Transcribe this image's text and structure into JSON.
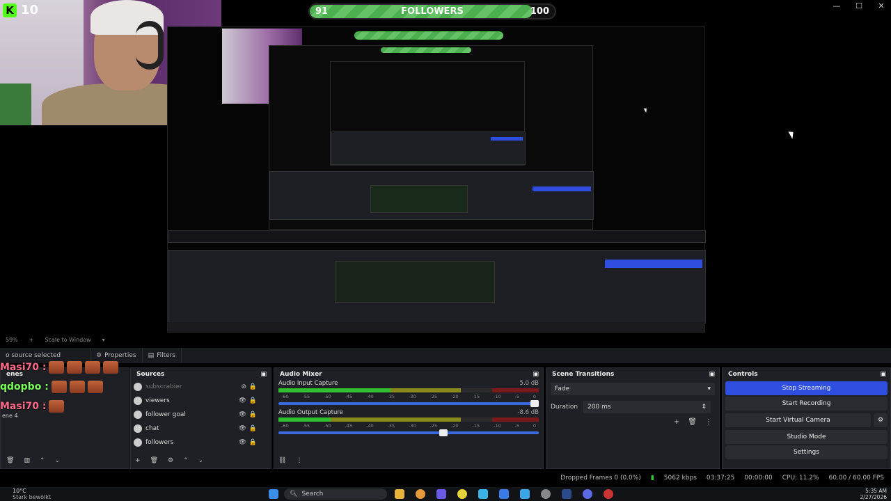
{
  "webcam": {
    "kick_count": "10"
  },
  "followers_bar": {
    "current": "91",
    "label": "FOLLOWERS",
    "goal": "100",
    "progress": 0.91
  },
  "window_controls": {
    "minimize": "—",
    "maximize": "☐",
    "close": "✕"
  },
  "preview_toolbar": {
    "zoom": "59%",
    "add": "+",
    "scale_mode": "Scale to Window"
  },
  "properties_bar": {
    "no_source": "o source selected",
    "properties_tab": "Properties",
    "filters_tab": "Filters"
  },
  "chat": [
    {
      "user": "Masi70 :",
      "color": "#ff6a8a",
      "emotes": 4
    },
    {
      "user": "qdopbo :",
      "color": "#7cff5a",
      "emotes": 3
    },
    {
      "user": "Masi70 :",
      "color": "#ff6a8a",
      "emotes": 1
    }
  ],
  "scenes_dock": {
    "title": "enes",
    "scene_label": "ene 4"
  },
  "sources_dock": {
    "title": "Sources",
    "items": [
      {
        "label": "subscrabier",
        "hidden": true
      },
      {
        "label": "viewers",
        "hidden": false
      },
      {
        "label": "follower goal",
        "hidden": false
      },
      {
        "label": "chat",
        "hidden": false
      },
      {
        "label": "followers",
        "hidden": false
      }
    ]
  },
  "audio_mixer": {
    "title": "Audio Mixer",
    "channels": [
      {
        "name": "Audio Input Capture",
        "db": "5.0 dB",
        "level": 0.43,
        "volume": 1.0
      },
      {
        "name": "Audio Output Capture",
        "db": "-8.6 dB",
        "level": 0.2,
        "volume": 0.65
      }
    ],
    "ticks": [
      "-60",
      "-55",
      "-50",
      "-45",
      "-40",
      "-35",
      "-30",
      "-25",
      "-20",
      "-15",
      "-10",
      "-5",
      "0"
    ]
  },
  "scene_transitions": {
    "title": "Scene Transitions",
    "transition": "Fade",
    "duration_label": "Duration",
    "duration_value": "200 ms"
  },
  "controls": {
    "title": "Controls",
    "stop_streaming": "Stop Streaming",
    "start_recording": "Start Recording",
    "start_virtual_camera": "Start Virtual Camera",
    "studio_mode": "Studio Mode",
    "settings": "Settings"
  },
  "status": {
    "dropped_frames": "Dropped Frames 0 (0.0%)",
    "bitrate": "5062 kbps",
    "stream_time": "03:37:25",
    "record_time": "00:00:00",
    "cpu": "CPU: 11.2%",
    "fps": "60.00 / 60.00 FPS"
  },
  "taskbar": {
    "weather_temp": "10°C",
    "weather_desc": "Stark bewölkt",
    "search": "Search",
    "time": "5:35 AM",
    "date": "2/27/2026"
  },
  "colors": {
    "accent": "#2e4ee0",
    "green": "#4caf50",
    "dock_bg": "#1f2025"
  }
}
